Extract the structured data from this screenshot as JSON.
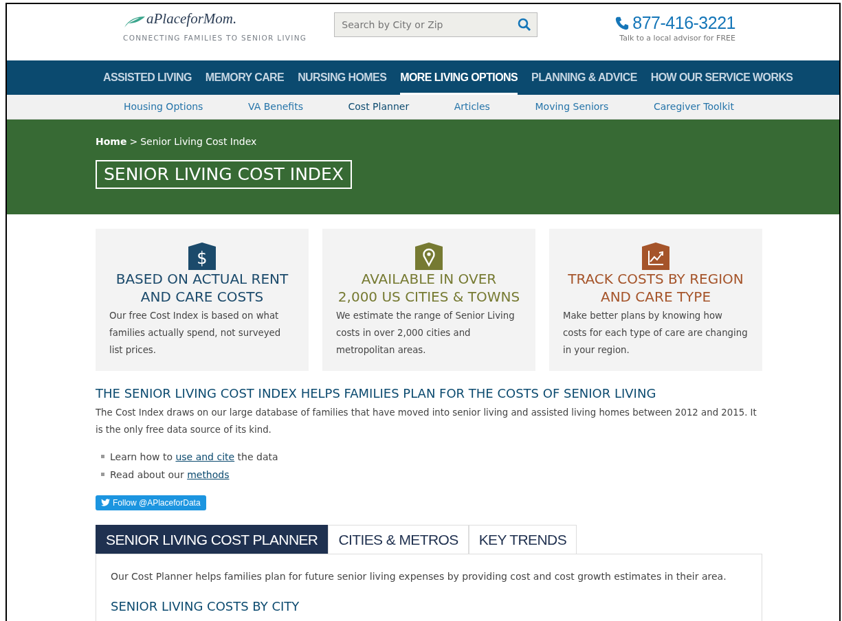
{
  "header": {
    "logo_text": "aPlaceforMom.",
    "tagline": "CONNECTING FAMILIES TO SENIOR LIVING",
    "search": {
      "placeholder": "Search by City or Zip"
    },
    "phone": "877-416-3221",
    "phone_note": "Talk to a local advisor for FREE"
  },
  "main_nav": [
    {
      "label": "ASSISTED LIVING",
      "selected": false
    },
    {
      "label": "MEMORY CARE",
      "selected": false
    },
    {
      "label": "NURSING HOMES",
      "selected": false
    },
    {
      "label": "MORE LIVING OPTIONS",
      "selected": true
    },
    {
      "label": "PLANNING & ADVICE",
      "selected": false
    },
    {
      "label": "HOW OUR SERVICE WORKS",
      "selected": false
    }
  ],
  "sub_nav": [
    {
      "label": "Housing Options",
      "selected": false
    },
    {
      "label": "VA Benefits",
      "selected": false
    },
    {
      "label": "Cost Planner",
      "selected": true
    },
    {
      "label": "Articles",
      "selected": false
    },
    {
      "label": "Moving Seniors",
      "selected": false
    },
    {
      "label": "Caregiver Toolkit",
      "selected": false
    }
  ],
  "breadcrumb": {
    "home": "Home",
    "separator": ">",
    "current": "Senior Living Cost Index"
  },
  "page_title": "SENIOR LIVING COST INDEX",
  "features": [
    {
      "kind": "dollar",
      "color": "#1b4a6b",
      "icon_glyph": "$",
      "title_lines": [
        "BASED ON ACTUAL RENT",
        "AND CARE COSTS"
      ],
      "text": "Our free Cost Index is based on what families actually spend, not surveyed list prices."
    },
    {
      "kind": "pin",
      "color": "#767a32",
      "title_lines": [
        "AVAILABLE IN OVER",
        "2,000 US CITIES & TOWNS"
      ],
      "text": "We estimate the range of Senior Living costs in over 2,000 cities and metropolitan areas."
    },
    {
      "kind": "chart",
      "color": "#a5542a",
      "title_lines": [
        "TRACK COSTS BY REGION",
        "AND CARE TYPE"
      ],
      "text": "Make better plans by knowing how costs for each type of care are changing in your region."
    }
  ],
  "intro": {
    "heading": "THE SENIOR LIVING COST INDEX HELPS FAMILIES PLAN FOR THE COSTS OF SENIOR LIVING",
    "text": "The Cost Index draws on our large database of families that have moved into senior living and assisted living homes between 2012 and 2015. It is the only free data source of its kind.",
    "bullets": [
      {
        "before": "Learn how to",
        "link": "use and cite",
        "after": "the data"
      },
      {
        "before": "Read about our",
        "link": "methods"
      }
    ]
  },
  "follow_button": "Follow @APlaceforData",
  "tabs": [
    {
      "label": "SENIOR LIVING COST PLANNER",
      "selected": true
    },
    {
      "label": "CITIES & METROS",
      "selected": false
    },
    {
      "label": "KEY TRENDS",
      "selected": false
    }
  ],
  "tab_panel": {
    "text": "Our Cost Planner helps families plan for future senior living expenses by providing cost and cost growth estimates in their area.",
    "heading": "SENIOR LIVING COSTS BY CITY"
  }
}
